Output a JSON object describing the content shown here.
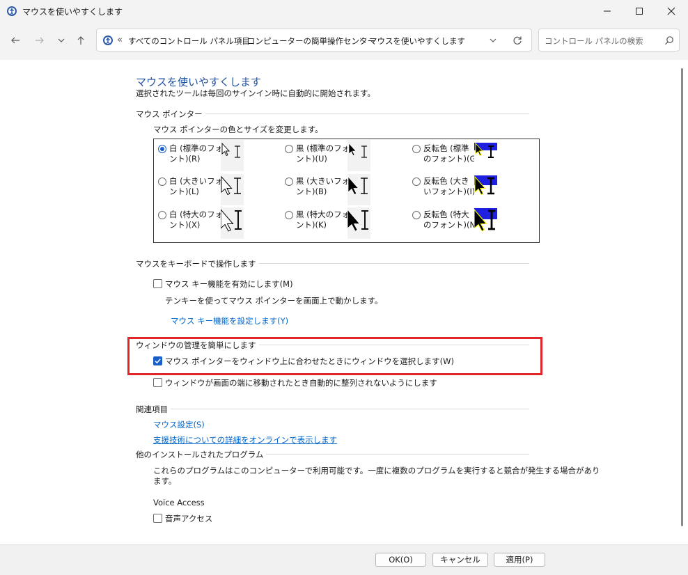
{
  "window": {
    "title": "マウスを使いやすくします"
  },
  "breadcrumb": {
    "overflow": "«",
    "items": [
      "すべてのコントロール パネル項目",
      "コンピューターの簡単操作センター",
      "マウスを使いやすくします"
    ]
  },
  "search": {
    "placeholder": "コントロール パネルの検索"
  },
  "page": {
    "title": "マウスを使いやすくします",
    "subtitle": "選択されたツールは毎回のサインイン時に自動的に開始されます。"
  },
  "pointer_section": {
    "title": "マウス ポインター",
    "desc": "マウス ポインターの色とサイズを変更します。",
    "options": [
      {
        "line1": "白 (標準のフォ",
        "line2": "ント)(R)",
        "selected": true
      },
      {
        "line1": "黒 (標準のフォ",
        "line2": "ント)(U)",
        "selected": false
      },
      {
        "line1": "反転色 (標準",
        "line2": "のフォント)(G)",
        "selected": false
      },
      {
        "line1": "白 (大きいフォ",
        "line2": "ント)(L)",
        "selected": false
      },
      {
        "line1": "黒 (大きいフォ",
        "line2": "ント)(B)",
        "selected": false
      },
      {
        "line1": "反転色 (大き",
        "line2": "いフォント)(I)",
        "selected": false
      },
      {
        "line1": "白 (特大のフォ",
        "line2": "ント)(X)",
        "selected": false
      },
      {
        "line1": "黒 (特大のフォ",
        "line2": "ント)(K)",
        "selected": false
      },
      {
        "line1": "反転色 (特大",
        "line2": "のフォント)(N)",
        "selected": false
      }
    ]
  },
  "keyboard_section": {
    "title": "マウスをキーボードで操作します",
    "mousekeys_label": "マウス キー機能を有効にします(M)",
    "mousekeys_checked": false,
    "mousekeys_desc": "テンキーを使ってマウス ポインターを画面上で動かします。",
    "mousekeys_link": "マウス キー機能を設定します(Y)"
  },
  "window_section": {
    "title": "ウィンドウの管理を簡単にします",
    "hover_select_label": "マウス ポインターをウィンドウ上に合わせたときにウィンドウを選択します(W)",
    "hover_select_checked": true,
    "no_snap_label": "ウィンドウが画面の端に移動されたとき自動的に整列されないようにします",
    "no_snap_checked": false
  },
  "related_section": {
    "title": "関連項目",
    "link1": "マウス設定(S)",
    "link2": "支援技術についての詳細をオンラインで表示します"
  },
  "other_section": {
    "title": "他のインストールされたプログラム",
    "desc_line1": "これらのプログラムはこのコンピューターで利用可能です。一度に複数のプログラムを実行すると競合が発生する場合があり",
    "desc_line2": "ます。",
    "program_name": "Voice Access",
    "voice_label": "音声アクセス",
    "voice_checked": false
  },
  "footer": {
    "ok": "OK(O)",
    "cancel": "キャンセル",
    "apply": "適用(P)"
  },
  "colors": {
    "accent": "#1a5fc8",
    "link": "#0066cc",
    "title": "#1f4e9c",
    "highlight": "#e0262b"
  }
}
